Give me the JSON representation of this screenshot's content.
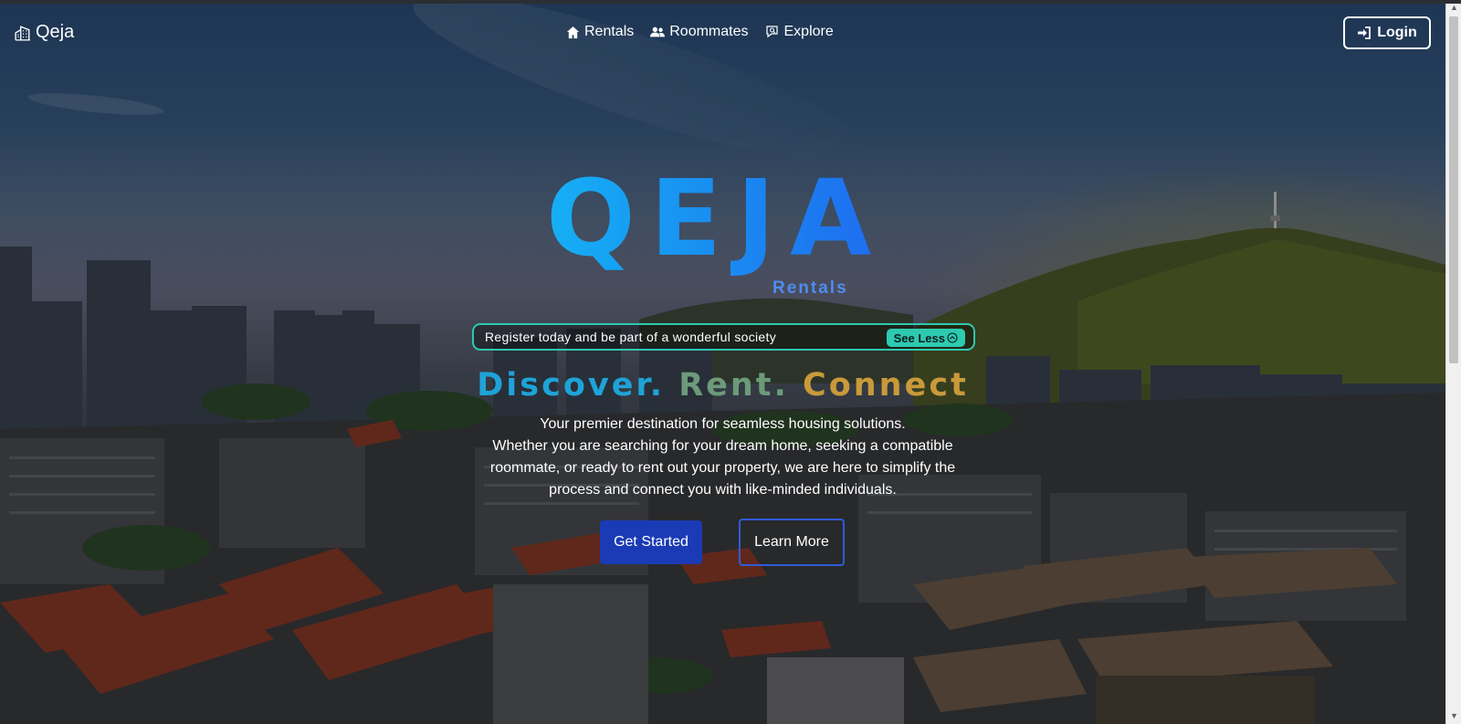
{
  "nav": {
    "brand": "Qeja",
    "links": [
      {
        "label": "Rentals",
        "icon": "house-icon"
      },
      {
        "label": "Roommates",
        "icon": "people-icon"
      },
      {
        "label": "Explore",
        "icon": "chat-search-icon"
      }
    ],
    "login_label": "Login"
  },
  "hero": {
    "title": "QEJA",
    "subtitle": "Rentals",
    "announcement": {
      "text": "Register today and be part of a wonderful society",
      "toggle_label": "See Less"
    },
    "tagline": {
      "part1": "Discover.",
      "part2": "Rent.",
      "part3": "Connect"
    },
    "description_lead": "Your premier destination for seamless housing solutions.",
    "description_body": "Whether you are searching for your dream home, seeking a compatible roommate, or ready to rent out your property, we are here to simplify the process and connect you with like-minded individuals.",
    "primary_button": "Get Started",
    "secondary_button": "Learn More"
  },
  "colors": {
    "title_gradient": [
      "#15b0f5",
      "#1f6cf0"
    ],
    "accent_teal": "#2ec9b1",
    "primary_blue": "#1a3bb5",
    "tagline_colors": [
      "#1ea3d8",
      "#6c9a7a",
      "#c99a3a"
    ]
  }
}
